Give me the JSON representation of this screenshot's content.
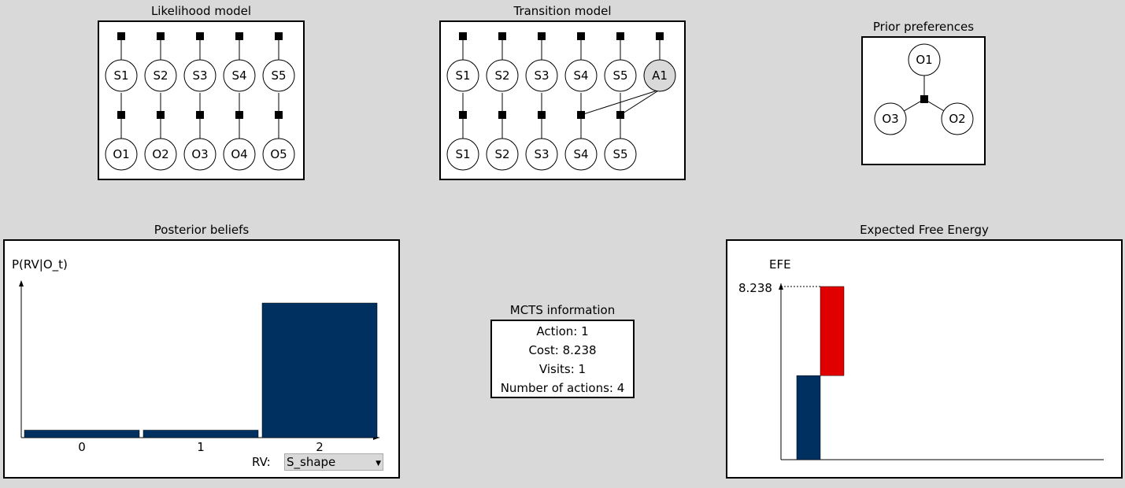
{
  "likelihood": {
    "title": "Likelihood model",
    "states": [
      "S1",
      "S2",
      "S3",
      "S4",
      "S5"
    ],
    "observations": [
      "O1",
      "O2",
      "O3",
      "O4",
      "O5"
    ]
  },
  "transition": {
    "title": "Transition model",
    "states": [
      "S1",
      "S2",
      "S3",
      "S4",
      "S5"
    ],
    "action": "A1",
    "next_states": [
      "S1",
      "S2",
      "S3",
      "S4",
      "S5"
    ]
  },
  "prior": {
    "title": "Prior preferences",
    "nodes": [
      "O1",
      "O3",
      "O2"
    ]
  },
  "posterior": {
    "title": "Posterior beliefs",
    "ylabel": "P(RV|O_t)",
    "rv_label": "RV:",
    "rv_value": "S_shape"
  },
  "mcts": {
    "title": "MCTS information",
    "lines": [
      "Action: 1",
      "Cost: 8.238",
      "Visits: 1",
      "Number of actions: 4"
    ]
  },
  "efe": {
    "title": "Expected Free Energy",
    "ylabel": "EFE",
    "max_label": "8.238"
  },
  "colors": {
    "belief_bar": "#003060",
    "efe_blue": "#003060",
    "efe_red": "#e00000",
    "action_node": "#d9d9d9"
  },
  "chart_data": [
    {
      "type": "bar",
      "title": "Posterior beliefs",
      "ylabel": "P(RV|O_t)",
      "xlabel": "RV",
      "categories": [
        "0",
        "1",
        "2"
      ],
      "values": [
        0.05,
        0.05,
        0.9
      ],
      "ylim": [
        0,
        1
      ]
    },
    {
      "type": "bar",
      "title": "Expected Free Energy",
      "ylabel": "EFE",
      "series": [
        {
          "values": [
            4.0
          ],
          "color": "#003060"
        },
        {
          "values": [
            4.238
          ],
          "color": "#e00000"
        }
      ],
      "ylim": [
        0,
        8.238
      ],
      "annotations": [
        "8.238"
      ]
    }
  ]
}
